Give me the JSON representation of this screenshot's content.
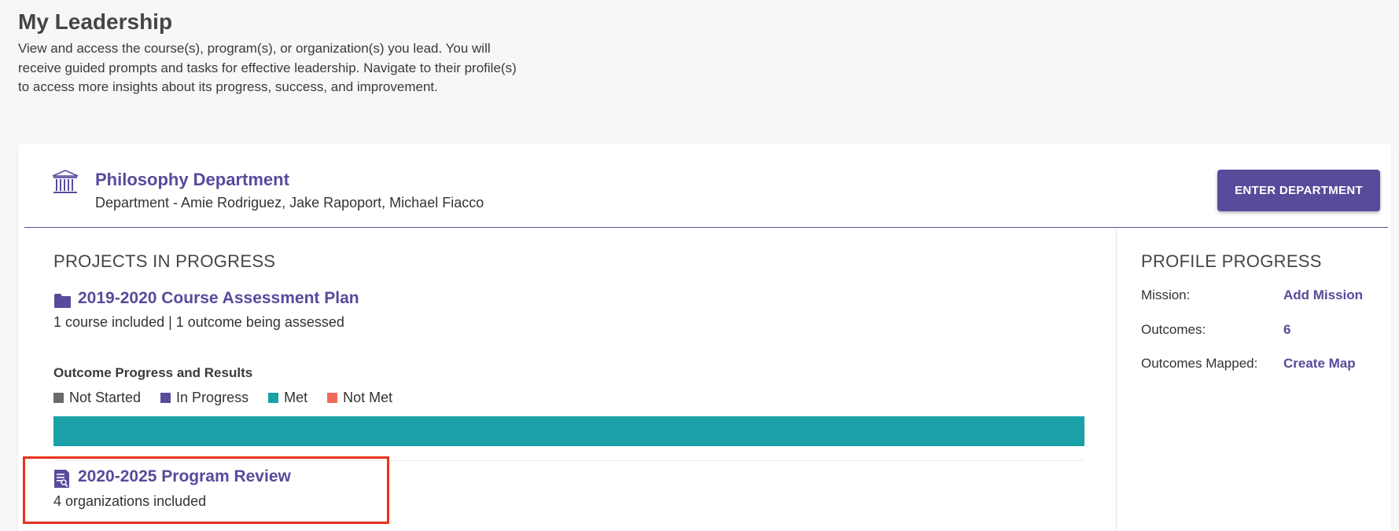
{
  "page": {
    "title": "My Leadership",
    "description": "View and access the course(s), program(s), or organization(s) you lead. You will receive guided prompts and tasks for effective leadership. Navigate to their profile(s) to access more insights about its progress, success, and improvement."
  },
  "department": {
    "icon": "institution-icon",
    "title": "Philosophy Department",
    "subtitle": "Department - Amie Rodriguez, Jake Rapoport, Michael Fiacco",
    "enter_label": "ENTER DEPARTMENT"
  },
  "projects": {
    "section_title": "PROJECTS IN PROGRESS",
    "items": [
      {
        "icon": "folder-icon",
        "title": "2019-2020 Course Assessment Plan",
        "meta": "1 course included | 1 outcome being assessed",
        "outcome_label": "Outcome Progress and Results",
        "legend": [
          {
            "label": "Not Started",
            "color": "#6b6b6b"
          },
          {
            "label": "In Progress",
            "color": "#574c9c"
          },
          {
            "label": "Met",
            "color": "#1aa1a7"
          },
          {
            "label": "Not Met",
            "color": "#f06a5a"
          }
        ],
        "progress": {
          "met": 1.0,
          "color": "#1aa1a7"
        }
      },
      {
        "icon": "program-review-icon",
        "title": "2020-2025 Program Review",
        "meta": "4 organizations included"
      }
    ]
  },
  "profile": {
    "section_title": "PROFILE PROGRESS",
    "rows": [
      {
        "label": "Mission:",
        "value": "Add Mission"
      },
      {
        "label": "Outcomes:",
        "value": "6"
      },
      {
        "label": "Outcomes Mapped:",
        "value": "Create Map"
      }
    ]
  },
  "colors": {
    "accent": "#574c9c",
    "highlight": "#e8321e"
  }
}
